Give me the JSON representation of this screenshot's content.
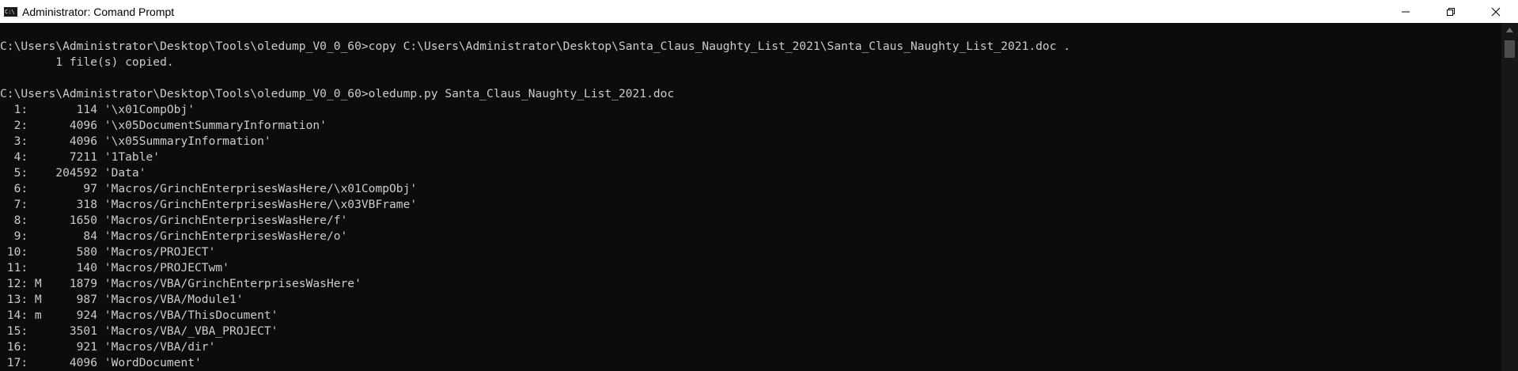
{
  "window": {
    "title": "Administrator: Comand Prompt",
    "icon_label": "C:\\"
  },
  "console": {
    "lines": [
      "",
      "C:\\Users\\Administrator\\Desktop\\Tools\\oledump_V0_0_60>copy C:\\Users\\Administrator\\Desktop\\Santa_Claus_Naughty_List_2021\\Santa_Claus_Naughty_List_2021.doc .",
      "        1 file(s) copied.",
      "",
      "C:\\Users\\Administrator\\Desktop\\Tools\\oledump_V0_0_60>oledump.py Santa_Claus_Naughty_List_2021.doc",
      "  1:       114 '\\x01CompObj'",
      "  2:      4096 '\\x05DocumentSummaryInformation'",
      "  3:      4096 '\\x05SummaryInformation'",
      "  4:      7211 '1Table'",
      "  5:    204592 'Data'",
      "  6:        97 'Macros/GrinchEnterprisesWasHere/\\x01CompObj'",
      "  7:       318 'Macros/GrinchEnterprisesWasHere/\\x03VBFrame'",
      "  8:      1650 'Macros/GrinchEnterprisesWasHere/f'",
      "  9:        84 'Macros/GrinchEnterprisesWasHere/o'",
      " 10:       580 'Macros/PROJECT'",
      " 11:       140 'Macros/PROJECTwm'",
      " 12: M    1879 'Macros/VBA/GrinchEnterprisesWasHere'",
      " 13: M     987 'Macros/VBA/Module1'",
      " 14: m     924 'Macros/VBA/ThisDocument'",
      " 15:      3501 'Macros/VBA/_VBA_PROJECT'",
      " 16:       921 'Macros/VBA/dir'",
      " 17:      4096 'WordDocument'"
    ]
  },
  "colors": {
    "console_bg": "#0c0c0c",
    "console_text": "#cccccc",
    "titlebar_bg": "#ffffff"
  }
}
